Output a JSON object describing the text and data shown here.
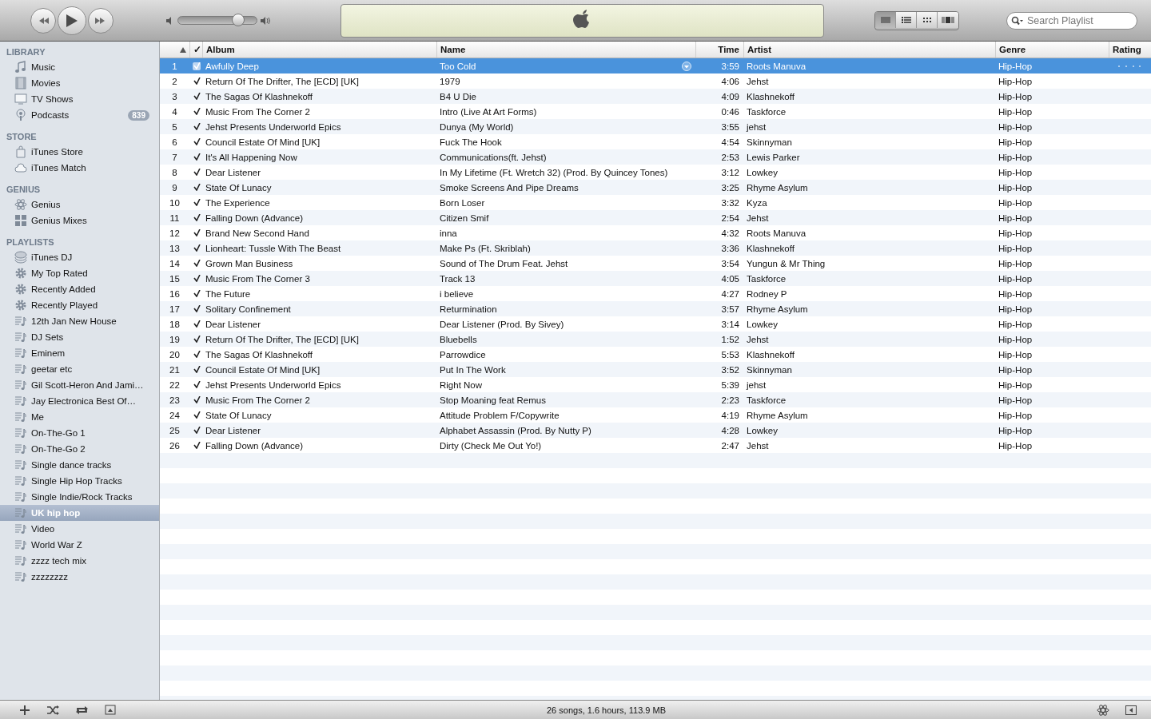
{
  "toolbar": {
    "transport": [
      {
        "kind": "previous"
      },
      {
        "kind": "play"
      },
      {
        "kind": "next"
      }
    ],
    "volume": {
      "level": 0.77
    },
    "view_modes": [
      {
        "kind": "list",
        "selected": true
      },
      {
        "kind": "album-list",
        "selected": false
      },
      {
        "kind": "grid",
        "selected": false
      },
      {
        "kind": "coverflow",
        "selected": false
      }
    ],
    "search": {
      "placeholder": "Search Playlist"
    }
  },
  "sidebar": {
    "sections": [
      {
        "title": "LIBRARY",
        "items": [
          {
            "label": "Music",
            "kind": "music",
            "selected": false
          },
          {
            "label": "Movies",
            "kind": "movies",
            "selected": false
          },
          {
            "label": "TV Shows",
            "kind": "tv",
            "selected": false
          },
          {
            "label": "Podcasts",
            "kind": "podcast",
            "selected": false,
            "badge": "839"
          }
        ]
      },
      {
        "title": "STORE",
        "items": [
          {
            "label": "iTunes Store",
            "kind": "store",
            "selected": false
          },
          {
            "label": "iTunes Match",
            "kind": "cloud",
            "selected": false
          }
        ]
      },
      {
        "title": "GENIUS",
        "items": [
          {
            "label": "Genius",
            "kind": "atom",
            "selected": false
          },
          {
            "label": "Genius Mixes",
            "kind": "mixes",
            "selected": false
          }
        ]
      },
      {
        "title": "PLAYLISTS",
        "items": [
          {
            "label": "iTunes DJ",
            "kind": "dj",
            "selected": false
          },
          {
            "label": "My Top Rated",
            "kind": "smart",
            "selected": false
          },
          {
            "label": "Recently Added",
            "kind": "smart",
            "selected": false
          },
          {
            "label": "Recently Played",
            "kind": "smart",
            "selected": false
          },
          {
            "label": "12th Jan New House",
            "kind": "playlist",
            "selected": false
          },
          {
            "label": "DJ Sets",
            "kind": "playlist",
            "selected": false
          },
          {
            "label": "Eminem",
            "kind": "playlist",
            "selected": false
          },
          {
            "label": "geetar etc",
            "kind": "playlist",
            "selected": false
          },
          {
            "label": "Gil Scott-Heron And Jami…",
            "kind": "playlist",
            "selected": false
          },
          {
            "label": "Jay Electronica Best Of…",
            "kind": "playlist",
            "selected": false
          },
          {
            "label": "Me",
            "kind": "playlist",
            "selected": false
          },
          {
            "label": "On-The-Go 1",
            "kind": "playlist",
            "selected": false
          },
          {
            "label": "On-The-Go 2",
            "kind": "playlist",
            "selected": false
          },
          {
            "label": "Single dance tracks",
            "kind": "playlist",
            "selected": false
          },
          {
            "label": "Single Hip Hop Tracks",
            "kind": "playlist",
            "selected": false
          },
          {
            "label": "Single Indie/Rock Tracks",
            "kind": "playlist",
            "selected": false
          },
          {
            "label": "UK hip hop",
            "kind": "playlist",
            "selected": true
          },
          {
            "label": "Video",
            "kind": "playlist",
            "selected": false
          },
          {
            "label": "World War Z",
            "kind": "playlist",
            "selected": false
          },
          {
            "label": "zzzz tech mix",
            "kind": "playlist",
            "selected": false
          },
          {
            "label": "zzzzzzzz",
            "kind": "playlist",
            "selected": false
          }
        ]
      }
    ]
  },
  "table": {
    "columns": [
      {
        "kind": "index",
        "sorted": true
      },
      {
        "kind": "check",
        "label": "✓"
      },
      {
        "kind": "text",
        "label": "Album"
      },
      {
        "kind": "text",
        "label": "Name"
      },
      {
        "kind": "time",
        "label": "Time"
      },
      {
        "kind": "text",
        "label": "Artist"
      },
      {
        "kind": "text",
        "label": "Genre"
      },
      {
        "kind": "text",
        "label": "Rating"
      }
    ],
    "rows": [
      {
        "number": "1",
        "checked": true,
        "album": "Awfully Deep",
        "name": "Too Cold",
        "time": "3:59",
        "artist": "Roots Manuva",
        "genre": "Hip-Hop",
        "selected": true
      },
      {
        "number": "2",
        "checked": true,
        "album": "Return Of The Drifter, The [ECD] [UK]",
        "name": "1979",
        "time": "4:06",
        "artist": "Jehst",
        "genre": "Hip-Hop",
        "selected": false
      },
      {
        "number": "3",
        "checked": true,
        "album": "The Sagas Of Klashnekoff",
        "name": "B4 U Die",
        "time": "4:09",
        "artist": "Klashnekoff",
        "genre": "Hip-Hop",
        "selected": false
      },
      {
        "number": "4",
        "checked": true,
        "album": "Music From The Corner 2",
        "name": "Intro (Live At Art Forms)",
        "time": "0:46",
        "artist": "Taskforce",
        "genre": "Hip-Hop",
        "selected": false
      },
      {
        "number": "5",
        "checked": true,
        "album": "Jehst Presents Underworld Epics",
        "name": "Dunya (My World)",
        "time": "3:55",
        "artist": "jehst",
        "genre": "Hip-Hop",
        "selected": false
      },
      {
        "number": "6",
        "checked": true,
        "album": "Council Estate Of Mind [UK]",
        "name": "Fuck The Hook",
        "time": "4:54",
        "artist": "Skinnyman",
        "genre": "Hip-Hop",
        "selected": false
      },
      {
        "number": "7",
        "checked": true,
        "album": "It's All Happening Now",
        "name": "Communications(ft. Jehst)",
        "time": "2:53",
        "artist": "Lewis Parker",
        "genre": "Hip-Hop",
        "selected": false
      },
      {
        "number": "8",
        "checked": true,
        "album": "Dear Listener",
        "name": "In My Lifetime (Ft. Wretch 32) (Prod. By Quincey Tones)",
        "time": "3:12",
        "artist": "Lowkey",
        "genre": "Hip-Hop",
        "selected": false
      },
      {
        "number": "9",
        "checked": true,
        "album": "State Of Lunacy",
        "name": "Smoke Screens And Pipe Dreams",
        "time": "3:25",
        "artist": "Rhyme Asylum",
        "genre": "Hip-Hop",
        "selected": false
      },
      {
        "number": "10",
        "checked": true,
        "album": "The Experience",
        "name": "Born Loser",
        "time": "3:32",
        "artist": "Kyza",
        "genre": "Hip-Hop",
        "selected": false
      },
      {
        "number": "11",
        "checked": true,
        "album": "Falling Down (Advance)",
        "name": "Citizen Smif",
        "time": "2:54",
        "artist": "Jehst",
        "genre": "Hip-Hop",
        "selected": false
      },
      {
        "number": "12",
        "checked": true,
        "album": "Brand New Second Hand",
        "name": "inna",
        "time": "4:32",
        "artist": "Roots Manuva",
        "genre": "Hip-Hop",
        "selected": false
      },
      {
        "number": "13",
        "checked": true,
        "album": "Lionheart: Tussle With The Beast",
        "name": "Make Ps (Ft. Skriblah)",
        "time": "3:36",
        "artist": "Klashnekoff",
        "genre": "Hip-Hop",
        "selected": false
      },
      {
        "number": "14",
        "checked": true,
        "album": "Grown Man Business",
        "name": "Sound of The Drum Feat. Jehst",
        "time": "3:54",
        "artist": "Yungun & Mr Thing",
        "genre": "Hip-Hop",
        "selected": false
      },
      {
        "number": "15",
        "checked": true,
        "album": "Music From The Corner 3",
        "name": "Track 13",
        "time": "4:05",
        "artist": "Taskforce",
        "genre": "Hip-Hop",
        "selected": false
      },
      {
        "number": "16",
        "checked": true,
        "album": "The Future",
        "name": "i believe",
        "time": "4:27",
        "artist": "Rodney P",
        "genre": "Hip-Hop",
        "selected": false
      },
      {
        "number": "17",
        "checked": true,
        "album": "Solitary Confinement",
        "name": "Returmination",
        "time": "3:57",
        "artist": "Rhyme Asylum",
        "genre": "Hip-Hop",
        "selected": false
      },
      {
        "number": "18",
        "checked": true,
        "album": "Dear Listener",
        "name": "Dear Listener (Prod. By Sivey)",
        "time": "3:14",
        "artist": "Lowkey",
        "genre": "Hip-Hop",
        "selected": false
      },
      {
        "number": "19",
        "checked": true,
        "album": "Return Of The Drifter, The [ECD] [UK]",
        "name": "Bluebells",
        "time": "1:52",
        "artist": "Jehst",
        "genre": "Hip-Hop",
        "selected": false
      },
      {
        "number": "20",
        "checked": true,
        "album": "The Sagas Of Klashnekoff",
        "name": "Parrowdice",
        "time": "5:53",
        "artist": "Klashnekoff",
        "genre": "Hip-Hop",
        "selected": false
      },
      {
        "number": "21",
        "checked": true,
        "album": "Council Estate Of Mind [UK]",
        "name": "Put In The Work",
        "time": "3:52",
        "artist": "Skinnyman",
        "genre": "Hip-Hop",
        "selected": false
      },
      {
        "number": "22",
        "checked": true,
        "album": "Jehst Presents Underworld Epics",
        "name": "Right Now",
        "time": "5:39",
        "artist": "jehst",
        "genre": "Hip-Hop",
        "selected": false
      },
      {
        "number": "23",
        "checked": true,
        "album": "Music From The Corner 2",
        "name": "Stop Moaning feat Remus",
        "time": "2:23",
        "artist": "Taskforce",
        "genre": "Hip-Hop",
        "selected": false
      },
      {
        "number": "24",
        "checked": true,
        "album": "State Of Lunacy",
        "name": "Attitude Problem F/Copywrite",
        "time": "4:19",
        "artist": "Rhyme Asylum",
        "genre": "Hip-Hop",
        "selected": false
      },
      {
        "number": "25",
        "checked": true,
        "album": "Dear Listener",
        "name": "Alphabet Assassin (Prod. By Nutty P)",
        "time": "4:28",
        "artist": "Lowkey",
        "genre": "Hip-Hop",
        "selected": false
      },
      {
        "number": "26",
        "checked": true,
        "album": "Falling Down (Advance)",
        "name": "Dirty (Check Me Out Yo!)",
        "time": "2:47",
        "artist": "Jehst",
        "genre": "Hip-Hop",
        "selected": false
      }
    ]
  },
  "status_bar": {
    "summary": "26 songs, 1.6 hours, 113.9 MB"
  }
}
